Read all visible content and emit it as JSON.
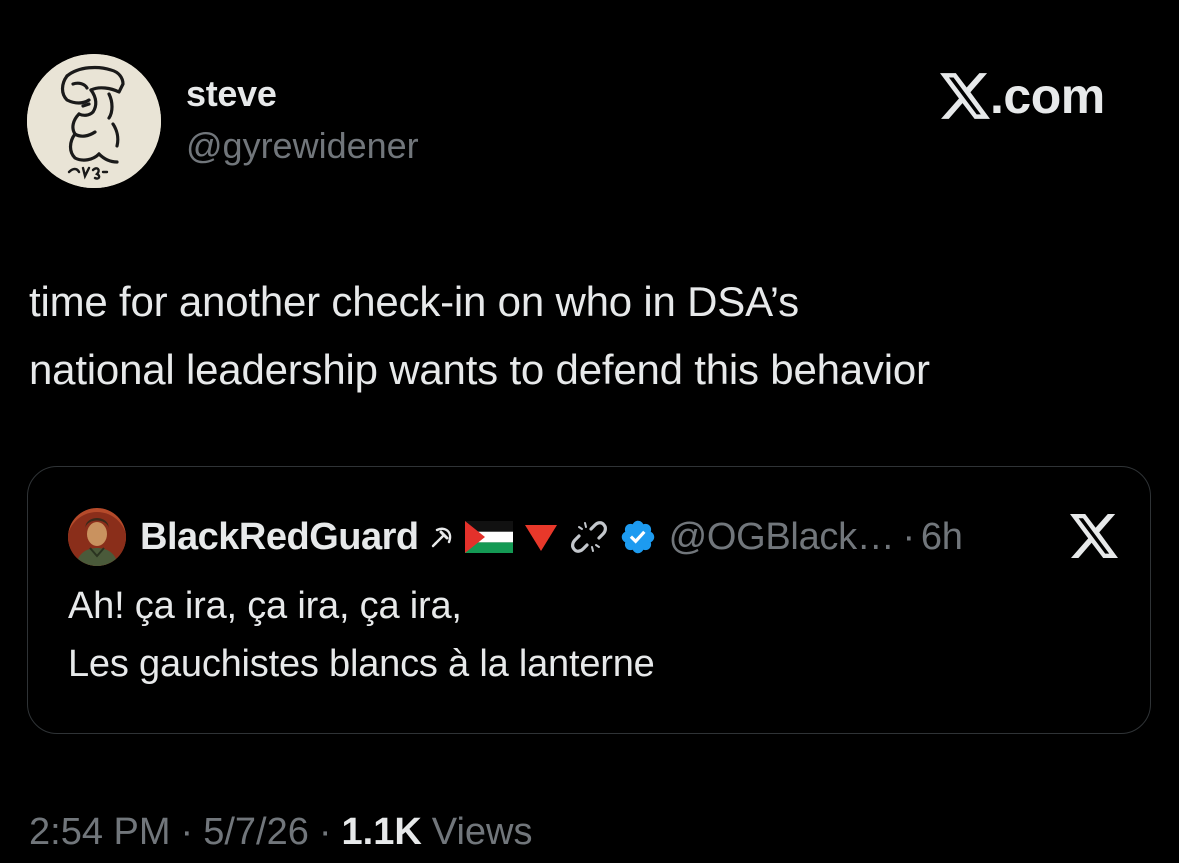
{
  "author": {
    "display_name": "steve",
    "handle": "@gyrewidener"
  },
  "brand": {
    "text": ".com"
  },
  "tweet": {
    "lines": [
      "time for another check-in on who in DSA’s",
      "national leadership wants to defend this behavior"
    ]
  },
  "quote": {
    "display_name": "BlackRedGuard",
    "badges": [
      "hammer-sickle-icon",
      "palestine-flag-icon",
      "red-triangle-icon",
      "broken-chain-icon",
      "verified-badge-icon"
    ],
    "handle": "@OGBlack…",
    "separator": "·",
    "time": "6h",
    "lines": [
      "Ah! ça ira, ça ira, ça ira,",
      "Les gauchistes blancs à la lanterne"
    ]
  },
  "meta": {
    "time": "2:54 PM",
    "date": "5/7/26",
    "separator": "·",
    "views_count": "1.1K",
    "views_label": "Views"
  },
  "colors": {
    "background": "#000000",
    "text_primary": "#e7e9ea",
    "text_secondary": "#71767b",
    "border": "#2f3336",
    "verified": "#1d9bf0"
  }
}
